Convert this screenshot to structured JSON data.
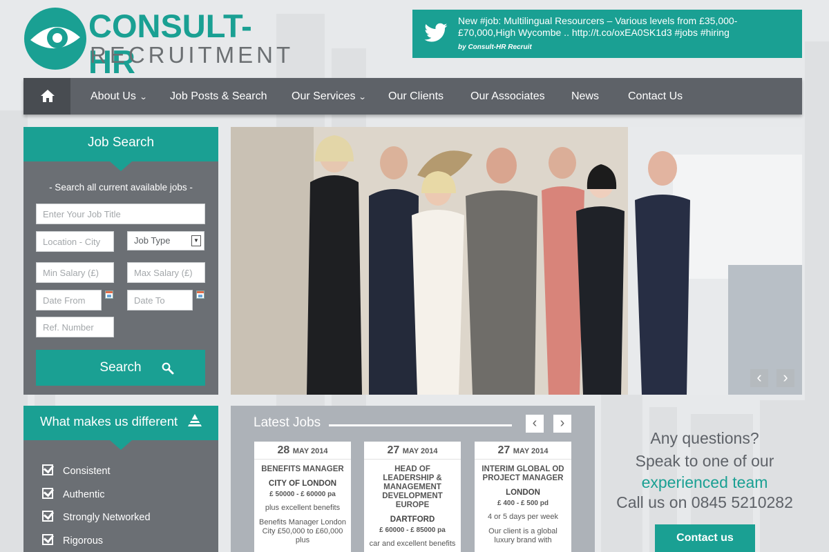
{
  "brand": {
    "name_top": "CONSULT-HR",
    "name_bottom": "RECRUITMENT"
  },
  "tweet": {
    "text": "New #job: Multilingual Resourcers – Various levels from £35,000-£70,000,High Wycombe .. http://t.co/oxEA0SK1d3 #jobs #hiring",
    "by": "by Consult-HR Recruit"
  },
  "nav": {
    "home_icon": "home-icon",
    "items": [
      {
        "label": "About Us",
        "dropdown": true
      },
      {
        "label": "Job Posts & Search",
        "dropdown": false
      },
      {
        "label": "Our Services",
        "dropdown": true
      },
      {
        "label": "Our Clients",
        "dropdown": false
      },
      {
        "label": "Our Associates",
        "dropdown": false
      },
      {
        "label": "News",
        "dropdown": false
      },
      {
        "label": "Contact Us",
        "dropdown": false
      }
    ]
  },
  "job_search": {
    "title": "Job Search",
    "subtitle": "- Search all current available jobs -",
    "job_title_placeholder": "Enter Your Job Title",
    "location_placeholder": "Location - City",
    "job_type": "Job Type",
    "min_salary_placeholder": "Min Salary (£)",
    "max_salary_placeholder": "Max Salary (£)",
    "date_from_placeholder": "Date From",
    "date_to_placeholder": "Date To",
    "ref_placeholder": "Ref. Number",
    "search_label": "Search"
  },
  "slider": {
    "prev": "‹",
    "next": "›"
  },
  "different": {
    "title": "What makes us different",
    "items": [
      "Consistent",
      "Authentic",
      "Strongly Networked",
      "Rigorous"
    ]
  },
  "latest_jobs": {
    "title": "Latest Jobs",
    "prev": "‹",
    "next": "›",
    "cards": [
      {
        "day": "28",
        "month": "MAY 2014",
        "title": "BENEFITS MANAGER",
        "location": "CITY OF LONDON",
        "salary": "£ 50000 - £ 60000 pa",
        "benefit": "plus excellent benefits",
        "desc": "Benefits Manager London City £50,000 to £60,000 plus"
      },
      {
        "day": "27",
        "month": "MAY 2014",
        "title": "HEAD OF LEADERSHIP & MANAGEMENT DEVELOPMENT EUROPE",
        "location": "DARTFORD",
        "salary": "£ 60000 - £ 85000 pa",
        "benefit": "car and excellent benefits",
        "desc": ""
      },
      {
        "day": "27",
        "month": "MAY 2014",
        "title": "INTERIM GLOBAL OD PROJECT MANAGER",
        "location": "LONDON",
        "salary": "£ 400 - £ 500 pd",
        "benefit": "4 or 5 days per week",
        "desc": "Our client is a global luxury brand with"
      }
    ]
  },
  "questions": {
    "line1": "Any questions?",
    "line2": "Speak to one of our",
    "line3": "experienced team",
    "line4": "Call us on 0845 5210282",
    "button": "Contact us"
  },
  "colors": {
    "accent": "#1aa093",
    "nav": "#5e6268",
    "panel": "#6b6f74",
    "jobs_panel": "#adb2b8"
  }
}
